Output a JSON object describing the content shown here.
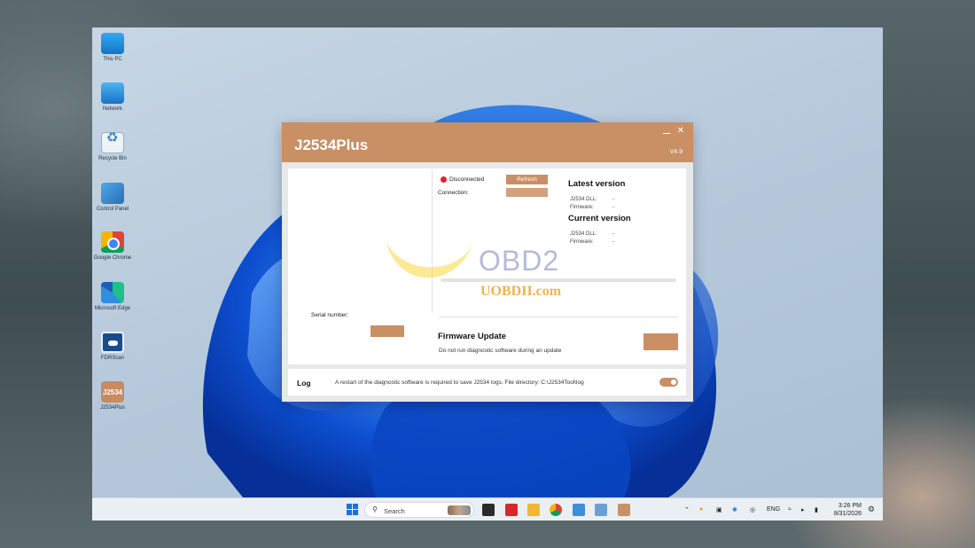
{
  "desktop": {
    "icons": [
      {
        "label": "This PC",
        "icon": "this-pc-icon"
      },
      {
        "label": "Network",
        "icon": "network-icon"
      },
      {
        "label": "Recycle Bin",
        "icon": "recycle-bin-icon"
      },
      {
        "label": "Control Panel",
        "icon": "control-panel-icon"
      },
      {
        "label": "Google Chrome",
        "icon": "chrome-icon"
      },
      {
        "label": "Microsoft Edge",
        "icon": "edge-icon"
      },
      {
        "label": "FDRScan",
        "icon": "fdrscan-icon"
      },
      {
        "label": "J2534Plus",
        "icon": "j2534plus-icon",
        "glyph": "J2534"
      }
    ]
  },
  "app": {
    "title": "J2534Plus",
    "version": "V4.9",
    "accent": "#c98f65",
    "device": {
      "status": "Disconnected",
      "status_color": "#d9262b",
      "refresh_label": "Refresh",
      "connection_label": "Connection:",
      "serial_label": "Serial number:"
    },
    "latest_version": {
      "heading": "Latest version",
      "rows": [
        {
          "label": "J2534 DLL:",
          "value": "-"
        },
        {
          "label": "Firmware:",
          "value": "-"
        }
      ]
    },
    "current_version": {
      "heading": "Current version",
      "rows": [
        {
          "label": "J2534 DLL:",
          "value": "-"
        },
        {
          "label": "Firmware:",
          "value": "-"
        }
      ]
    },
    "progress_fraction": 0,
    "firmware_update": {
      "title": "Firmware Update",
      "note": "Do not run diagnostic software during an update"
    },
    "log": {
      "title": "Log",
      "message": "A restart of the diagnostic software is required to save J2534 logs. File directory: C:\\J2534Tool\\log",
      "toggle_on": true
    }
  },
  "watermark": {
    "brand": "OBD2",
    "site": "UOBDII.com"
  },
  "taskbar": {
    "search_placeholder": "Search",
    "language": "ENG",
    "time": "3:26 PM",
    "date": "8/31/2026"
  }
}
